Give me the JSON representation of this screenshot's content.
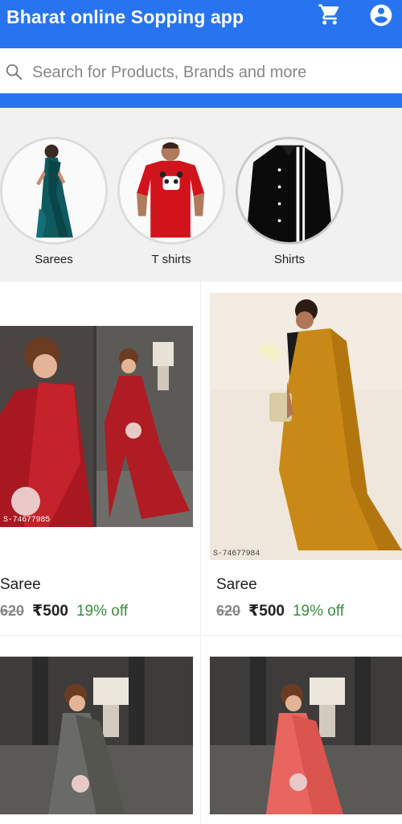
{
  "header": {
    "title": "Bharat online Sopping app",
    "cart_icon": "shopping-cart-icon",
    "account_icon": "account-circle-icon",
    "brand_color": "#2874f0"
  },
  "search": {
    "placeholder": "Search for Products, Brands and more",
    "value": ""
  },
  "categories": [
    {
      "label": "Sarees"
    },
    {
      "label": "T shirts"
    },
    {
      "label": "Shirts"
    }
  ],
  "products": [
    {
      "name": "Saree",
      "mrp": "620",
      "price": "₹500",
      "discount": "19% off",
      "image_code": "S-74677985"
    },
    {
      "name": "Saree",
      "mrp": "620",
      "price": "₹500",
      "discount": "19% off",
      "image_code": "S-74677984"
    },
    {
      "name": "",
      "mrp": "",
      "price": "",
      "discount": ""
    },
    {
      "name": "",
      "mrp": "",
      "price": "",
      "discount": ""
    }
  ],
  "colors": {
    "discount_green": "#388e3c",
    "strike_grey": "#878787"
  }
}
